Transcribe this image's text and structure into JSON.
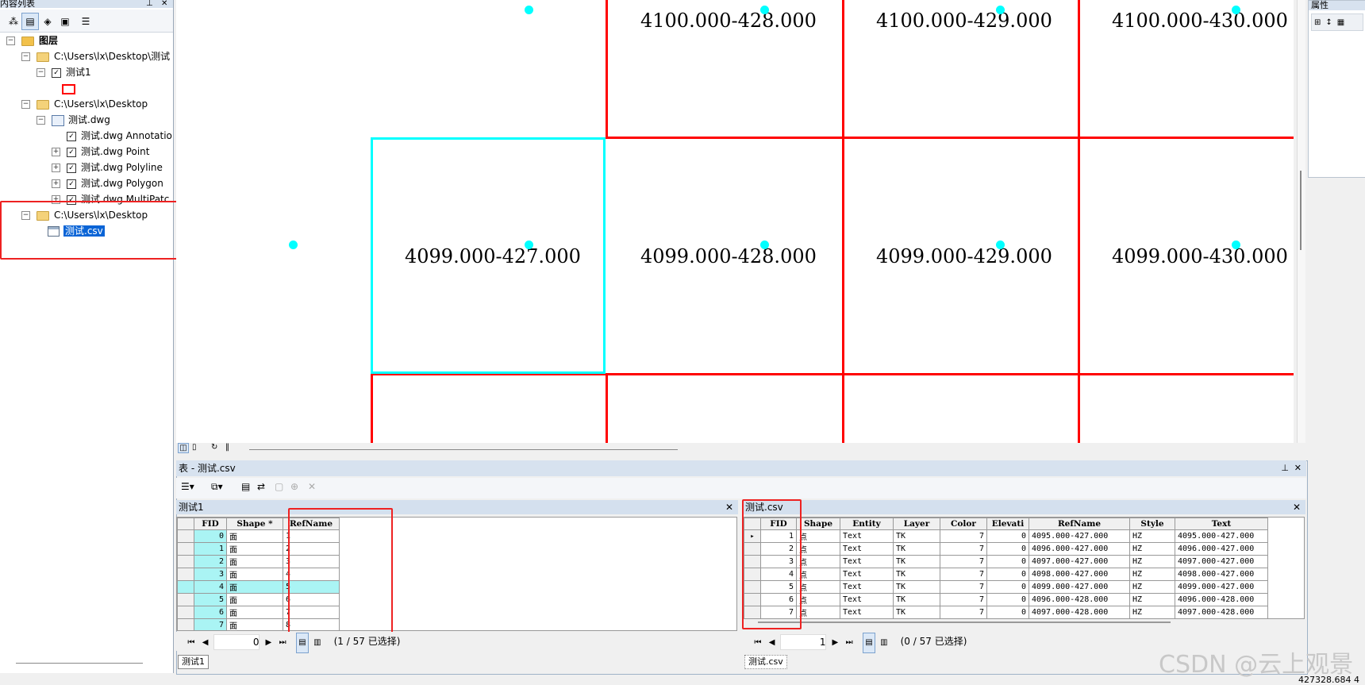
{
  "toc": {
    "title": "内容列表",
    "root_label": "图层",
    "group1_path": "C:\\Users\\lx\\Desktop\\测试",
    "layer_test1": "测试1",
    "group2_path": "C:\\Users\\lx\\Desktop",
    "dwg_label": "测试.dwg",
    "dwg_annotation": "测试.dwg Annotatio",
    "dwg_point": "测试.dwg Point",
    "dwg_polyline": "测试.dwg Polyline",
    "dwg_polygon": "测试.dwg Polygon",
    "dwg_multipatch": "测试.dwg MultiPatc",
    "group3_path": "C:\\Users\\lx\\Desktop",
    "csv_label": "测试.csv"
  },
  "map": {
    "labels": [
      "4100.000-428.000",
      "4100.000-429.000",
      "4100.000-430.000",
      "4099.000-427.000",
      "4099.000-428.000",
      "4099.000-429.000",
      "4099.000-430.000"
    ]
  },
  "prop_panel": {
    "title": "属性"
  },
  "table_window": {
    "title": "表 - 测试.csv",
    "left": {
      "pane_title": "测试1",
      "headers": [
        "FID",
        "Shape *",
        "RefName"
      ],
      "rows": [
        [
          "0",
          "面",
          "1"
        ],
        [
          "1",
          "面",
          "2"
        ],
        [
          "2",
          "面",
          "3"
        ],
        [
          "3",
          "面",
          "4"
        ],
        [
          "4",
          "面",
          "5"
        ],
        [
          "5",
          "面",
          "6"
        ],
        [
          "6",
          "面",
          "7"
        ],
        [
          "7",
          "面",
          "8"
        ]
      ],
      "selected_row": 4,
      "record_value": "0",
      "selection_status": "(1 / 57 已选择)",
      "tab_label": "测试1"
    },
    "right": {
      "pane_title": "测试.csv",
      "headers": [
        "FID",
        "Shape",
        "Entity",
        "Layer",
        "Color",
        "Elevati",
        "RefName",
        "Style",
        "Text"
      ],
      "rows": [
        [
          "1",
          "点",
          "Text",
          "TK",
          "7",
          "0",
          "4095.000-427.000",
          "HZ",
          "4095.000-427.000"
        ],
        [
          "2",
          "点",
          "Text",
          "TK",
          "7",
          "0",
          "4096.000-427.000",
          "HZ",
          "4096.000-427.000"
        ],
        [
          "3",
          "点",
          "Text",
          "TK",
          "7",
          "0",
          "4097.000-427.000",
          "HZ",
          "4097.000-427.000"
        ],
        [
          "4",
          "点",
          "Text",
          "TK",
          "7",
          "0",
          "4098.000-427.000",
          "HZ",
          "4098.000-427.000"
        ],
        [
          "5",
          "点",
          "Text",
          "TK",
          "7",
          "0",
          "4099.000-427.000",
          "HZ",
          "4099.000-427.000"
        ],
        [
          "6",
          "点",
          "Text",
          "TK",
          "7",
          "0",
          "4096.000-428.000",
          "HZ",
          "4096.000-428.000"
        ],
        [
          "7",
          "点",
          "Text",
          "TK",
          "7",
          "0",
          "4097.000-428.000",
          "HZ",
          "4097.000-428.000"
        ]
      ],
      "record_value": "1",
      "selection_status": "(0 / 57 已选择)",
      "tab_label": "测试.csv"
    }
  },
  "watermark": "CSDN @云上观景",
  "status_coords": "427328.684  4"
}
